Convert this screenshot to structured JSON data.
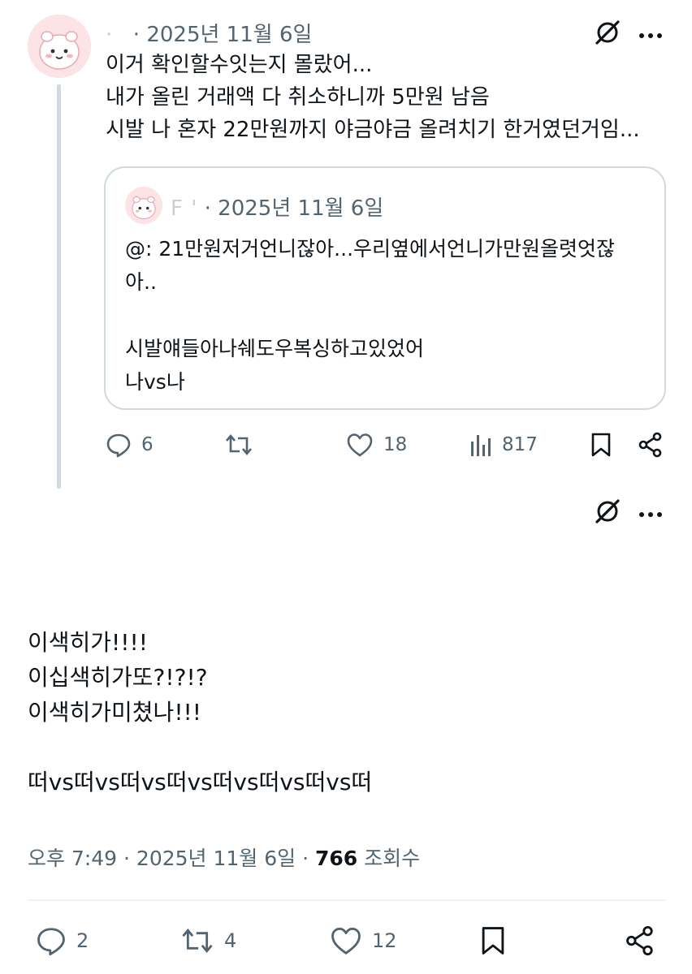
{
  "thread": {
    "tweet": {
      "name_faint": "·",
      "date": "· 2025년 11월 6일",
      "lines": [
        "이거 확인할수잇는지 몰랐어...",
        "내가 올린 거래액 다 취소하니까 5만원 남음",
        "시발 나 혼자 22만원까지 야금야금 올려치기 한거였던거임..."
      ],
      "quote": {
        "name_faint": "F                       '",
        "date": "· 2025년 11월 6일",
        "lines": [
          "@: 21만원저거언니잖아...우리옆에서언니가만원올렷엇잖",
          "아..",
          "",
          "시발얘들아나쉐도우복싱하고있었어",
          "나vs나"
        ]
      },
      "actions": {
        "replies": "6",
        "retweets": "",
        "likes": "18",
        "views": "817"
      }
    }
  },
  "main": {
    "lines": [
      "이색히가!!!!",
      "이십색히가또?!?!?",
      "이색히가미쳤나!!!",
      "",
      "떠vs떠vs떠vs떠vs떠vs떠vs떠vs떠"
    ],
    "timestamp": {
      "time": "오후 7:49 · 2025년 11월 6일 · ",
      "views": "766",
      "views_label": " 조회수"
    },
    "actions": {
      "replies": "2",
      "retweets": "4",
      "likes": "12"
    }
  },
  "colors": {
    "text": "#0f1419",
    "secondary": "#536471",
    "border": "#cfd9de"
  },
  "icons": [
    "grok-icon",
    "more-icon",
    "reply-icon",
    "retweet-icon",
    "like-icon",
    "views-icon",
    "bookmark-icon",
    "share-icon"
  ]
}
